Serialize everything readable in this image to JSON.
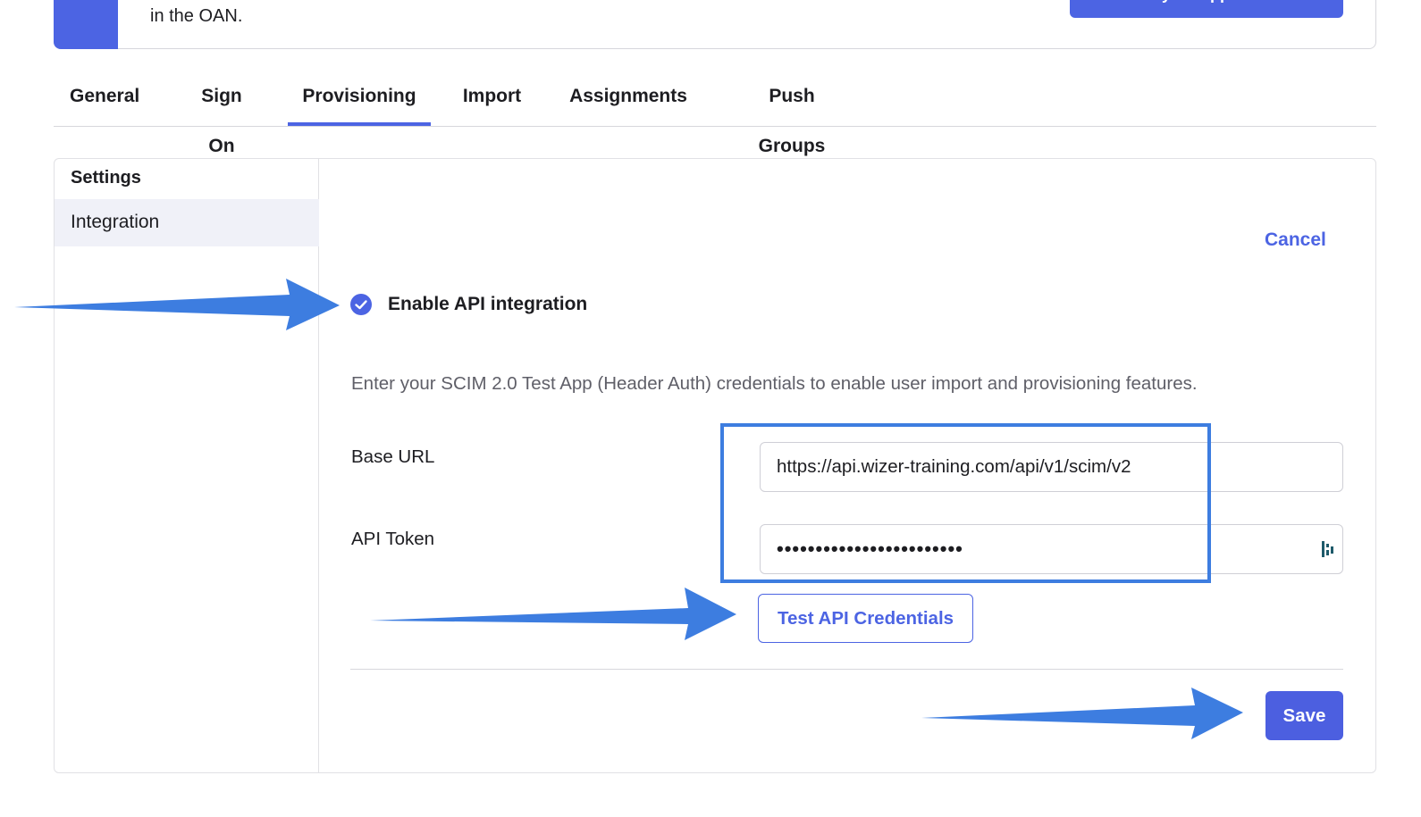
{
  "banner": {
    "text": "in the OAN.",
    "button_label": "Submit your app for review"
  },
  "tabs": [
    {
      "label": "General"
    },
    {
      "label": "Sign On"
    },
    {
      "label": "Provisioning",
      "active": true
    },
    {
      "label": "Import"
    },
    {
      "label": "Assignments"
    },
    {
      "label": "Push Groups"
    }
  ],
  "sidebar": {
    "title": "Settings",
    "items": [
      {
        "label": "Integration",
        "selected": true
      }
    ]
  },
  "form": {
    "cancel_label": "Cancel",
    "enable_api": {
      "label": "Enable API integration",
      "checked": true
    },
    "description": "Enter your SCIM 2.0 Test App (Header Auth) credentials to enable user import and provisioning features.",
    "base_url": {
      "label": "Base URL",
      "value": "https://api.wizer-training.com/api/v1/scim/v2"
    },
    "api_token": {
      "label": "API Token",
      "value": "••••••••••••••••••••••••"
    },
    "test_button_label": "Test API Credentials",
    "save_label": "Save"
  },
  "colors": {
    "accent": "#4c64e3",
    "annotation_arrow": "#3d7de0"
  },
  "icons": [
    "check-icon",
    "password-manager-icon",
    "annotation-arrow"
  ]
}
